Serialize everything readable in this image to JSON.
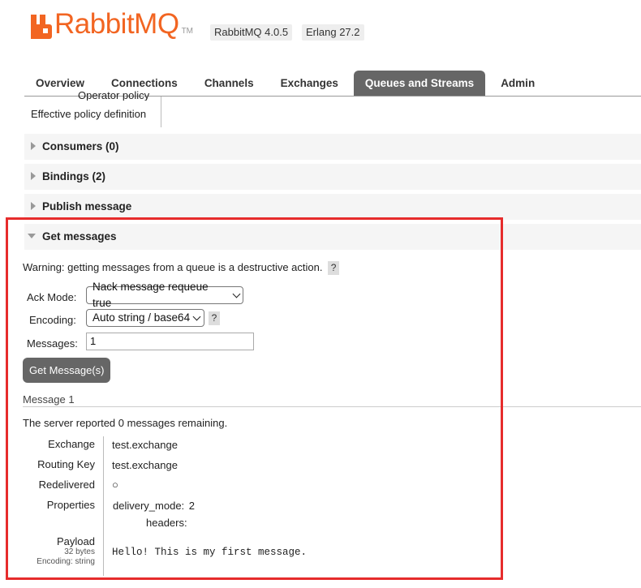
{
  "header": {
    "brand": "RabbitMQ",
    "tm": "TM",
    "version": "RabbitMQ 4.0.5",
    "erlang": "Erlang 27.2"
  },
  "nav": {
    "tabs": [
      {
        "label": "Overview"
      },
      {
        "label": "Connections"
      },
      {
        "label": "Channels"
      },
      {
        "label": "Exchanges"
      },
      {
        "label": "Queues and Streams",
        "active": true
      },
      {
        "label": "Admin"
      }
    ]
  },
  "policy": {
    "operator_policy": "Operator policy",
    "effective_policy": "Effective policy definition"
  },
  "sections": {
    "consumers": "Consumers (0)",
    "bindings": "Bindings (2)",
    "publish": "Publish message",
    "get": "Get messages"
  },
  "get_messages": {
    "warning": "Warning: getting messages from a queue is a destructive action.",
    "help": "?",
    "ack_mode_label": "Ack Mode:",
    "ack_mode_value": "Nack message requeue true",
    "encoding_label": "Encoding:",
    "encoding_value": "Auto string / base64",
    "messages_label": "Messages:",
    "messages_value": "1",
    "button": "Get Message(s)"
  },
  "message": {
    "title": "Message 1",
    "remaining_prefix": "The server reported ",
    "remaining_count": "0",
    "remaining_suffix": " messages remaining.",
    "exchange_label": "Exchange",
    "exchange_value": "test.exchange",
    "routing_key_label": "Routing Key",
    "routing_key_value": "test.exchange",
    "redelivered_label": "Redelivered",
    "redelivered_value": "○",
    "properties_label": "Properties",
    "delivery_mode_key": "delivery_mode:",
    "delivery_mode_value": "2",
    "headers_key": "headers:",
    "payload_label": "Payload",
    "payload_bytes": "32 bytes",
    "payload_encoding": "Encoding: string",
    "payload_value": "Hello! This is my first message."
  },
  "colors": {
    "brand": "#f26522",
    "tab_active": "#666666",
    "highlight": "#e62c2c"
  }
}
